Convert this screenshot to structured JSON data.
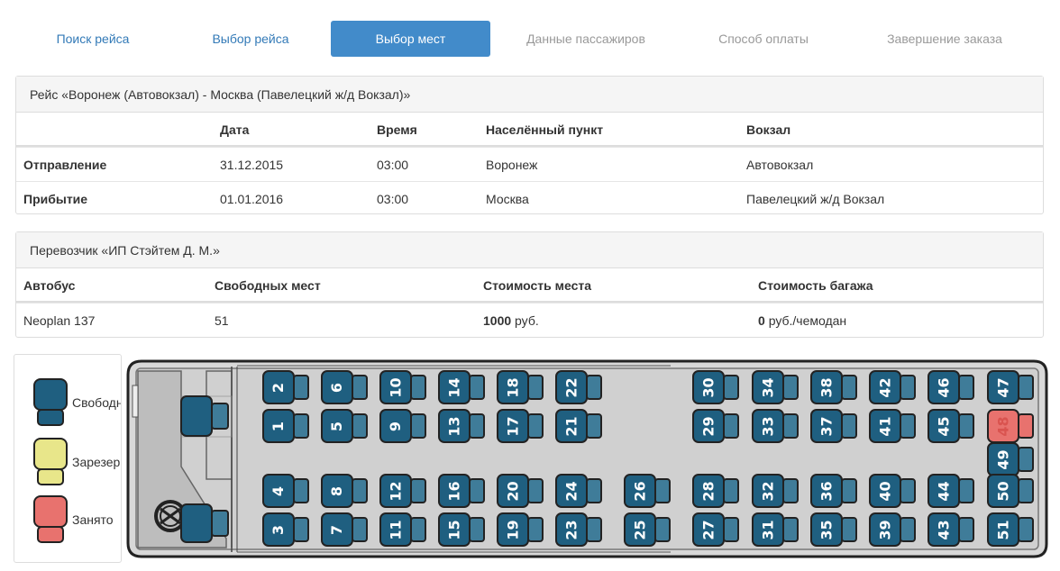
{
  "steps": [
    {
      "label": "Поиск рейса",
      "state": "link"
    },
    {
      "label": "Выбор рейса",
      "state": "link"
    },
    {
      "label": "Выбор мест",
      "state": "active"
    },
    {
      "label": "Данные пассажиров",
      "state": "disabled"
    },
    {
      "label": "Способ оплаты",
      "state": "disabled"
    },
    {
      "label": "Завершение заказа",
      "state": "disabled"
    }
  ],
  "trip": {
    "title": "Рейс «Воронеж (Автовокзал) - Москва (Павелецкий ж/д Вокзал)»",
    "headers": {
      "date": "Дата",
      "time": "Время",
      "city": "Населённый пункт",
      "station": "Вокзал"
    },
    "departure": {
      "label": "Отправление",
      "date": "31.12.2015",
      "time": "03:00",
      "city": "Воронеж",
      "station": "Автовокзал"
    },
    "arrival": {
      "label": "Прибытие",
      "date": "01.01.2016",
      "time": "03:00",
      "city": "Москва",
      "station": "Павелецкий ж/д Вокзал"
    }
  },
  "carrier": {
    "title": "Перевозчик «ИП Стэйтем Д. М.»",
    "headers": {
      "bus": "Автобус",
      "free": "Свободных мест",
      "price": "Стоимость места",
      "luggage": "Стоимость багажа"
    },
    "values": {
      "bus": "Neoplan 137",
      "free": "51",
      "price_value": "1000",
      "price_unit": "руб.",
      "luggage_value": "0",
      "luggage_unit": "руб./чемодан"
    }
  },
  "legend": [
    {
      "label": "Свободно",
      "color": "#1f5f80"
    },
    {
      "label": "Зарезервировано",
      "color": "#e8e68a"
    },
    {
      "label": "Занято",
      "color": "#e8726e"
    }
  ],
  "colors": {
    "accent": "#428bca",
    "link": "#337ab7",
    "seat_free": "#1f5f80",
    "seat_free_back": "#3f7c99",
    "seat_taken": "#e8726e",
    "bus_body": "#d8d8d8",
    "driver_area": "#bdbdbd"
  },
  "seats": [
    {
      "n": "1",
      "status": "free"
    },
    {
      "n": "2",
      "status": "free"
    },
    {
      "n": "3",
      "status": "free"
    },
    {
      "n": "4",
      "status": "free"
    },
    {
      "n": "5",
      "status": "free"
    },
    {
      "n": "6",
      "status": "free"
    },
    {
      "n": "7",
      "status": "free"
    },
    {
      "n": "8",
      "status": "free"
    },
    {
      "n": "9",
      "status": "free"
    },
    {
      "n": "10",
      "status": "free"
    },
    {
      "n": "11",
      "status": "free"
    },
    {
      "n": "12",
      "status": "free"
    },
    {
      "n": "13",
      "status": "free"
    },
    {
      "n": "14",
      "status": "free"
    },
    {
      "n": "15",
      "status": "free"
    },
    {
      "n": "16",
      "status": "free"
    },
    {
      "n": "17",
      "status": "free"
    },
    {
      "n": "18",
      "status": "free"
    },
    {
      "n": "19",
      "status": "free"
    },
    {
      "n": "20",
      "status": "free"
    },
    {
      "n": "21",
      "status": "free"
    },
    {
      "n": "22",
      "status": "free"
    },
    {
      "n": "23",
      "status": "free"
    },
    {
      "n": "24",
      "status": "free"
    },
    {
      "n": "25",
      "status": "free"
    },
    {
      "n": "26",
      "status": "free"
    },
    {
      "n": "27",
      "status": "free"
    },
    {
      "n": "28",
      "status": "free"
    },
    {
      "n": "29",
      "status": "free"
    },
    {
      "n": "30",
      "status": "free"
    },
    {
      "n": "31",
      "status": "free"
    },
    {
      "n": "32",
      "status": "free"
    },
    {
      "n": "33",
      "status": "free"
    },
    {
      "n": "34",
      "status": "free"
    },
    {
      "n": "35",
      "status": "free"
    },
    {
      "n": "36",
      "status": "free"
    },
    {
      "n": "37",
      "status": "free"
    },
    {
      "n": "38",
      "status": "free"
    },
    {
      "n": "39",
      "status": "free"
    },
    {
      "n": "40",
      "status": "free"
    },
    {
      "n": "41",
      "status": "free"
    },
    {
      "n": "42",
      "status": "free"
    },
    {
      "n": "43",
      "status": "free"
    },
    {
      "n": "44",
      "status": "free"
    },
    {
      "n": "45",
      "status": "free"
    },
    {
      "n": "46",
      "status": "free"
    },
    {
      "n": "47",
      "status": "free"
    },
    {
      "n": "48",
      "status": "taken"
    },
    {
      "n": "49",
      "status": "free"
    },
    {
      "n": "50",
      "status": "free"
    },
    {
      "n": "51",
      "status": "free"
    }
  ]
}
